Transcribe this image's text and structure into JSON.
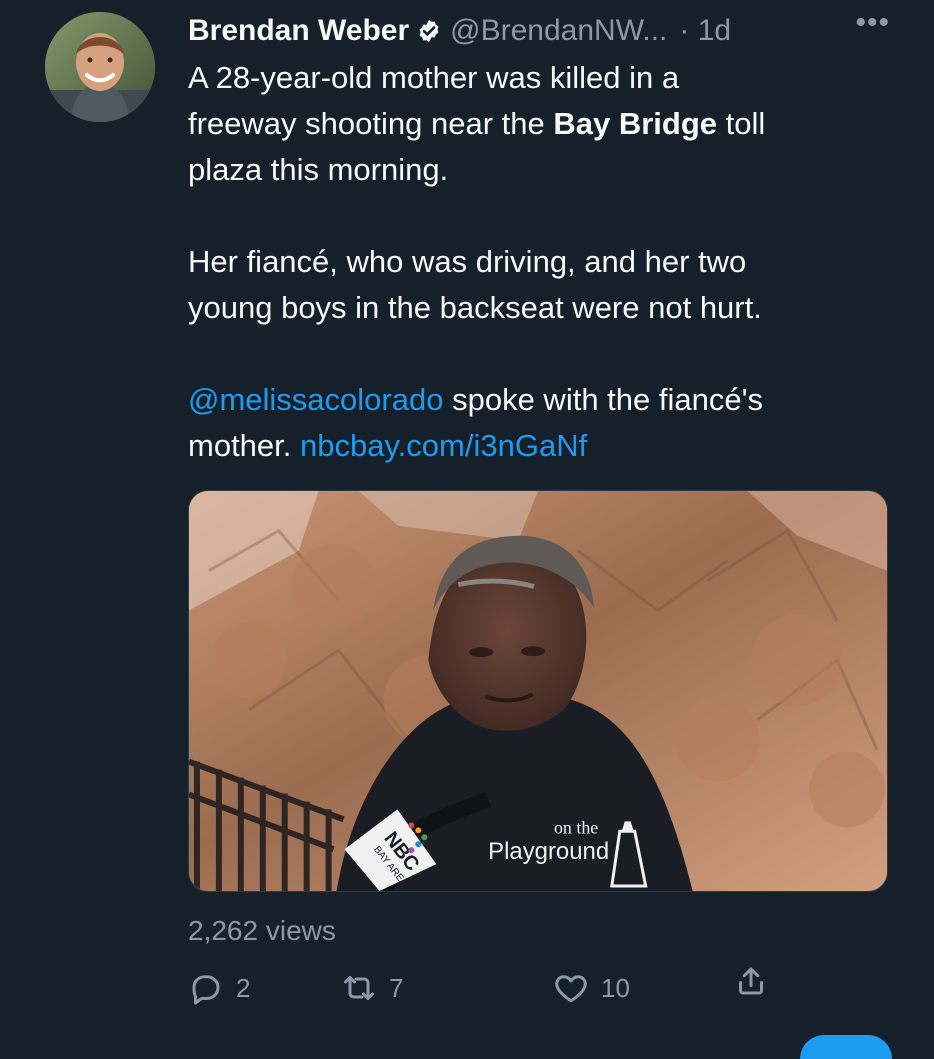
{
  "tweet": {
    "author": {
      "name": "Brendan Weber",
      "handle": "@BrendanNW...",
      "time": "· 1d",
      "more_icon": "more-dots-icon",
      "verified_icon": "verified-badge-icon"
    },
    "text": {
      "line1": "A 28-year-old mother was killed in a",
      "line2_prefix": "freeway shooting near the",
      "line2_bold": "Bay Bridge",
      "line2_suffix": "toll",
      "line3": "plaza this morning.",
      "line4": "Her fiancé, who was driving, and her two",
      "line5": "young boys in the backseat were not hurt.",
      "line6_mention": "@melissacolorado",
      "line6_suffix": "spoke with the fiancé's",
      "line7_prefix": "mother.",
      "line7_link": "nbcbay.com/i3nGaNf"
    },
    "media": {
      "shirt_line1": "on the",
      "shirt_line2": "Playground",
      "mic_line1": "NBC",
      "mic_line2": "BAY AREA"
    },
    "views": "2,262 views",
    "actions": {
      "reply_count": "2",
      "retweet_count": "7",
      "like_count": "10"
    }
  },
  "colors": {
    "background": "#15202b",
    "text": "#f7f9f9",
    "muted": "#8b98a5",
    "link": "#1d9bf0"
  }
}
